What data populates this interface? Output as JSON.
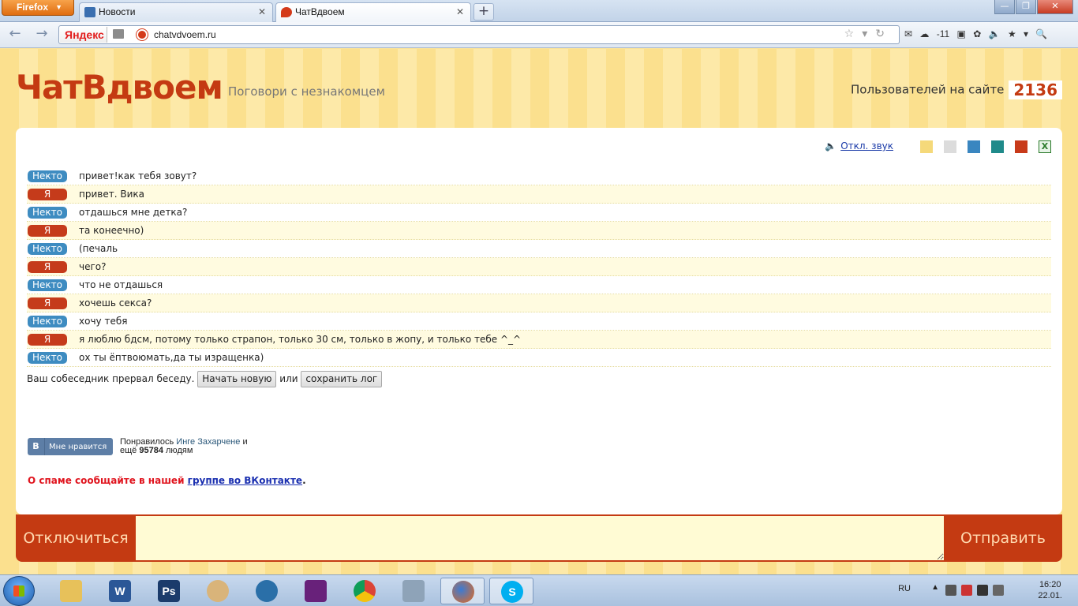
{
  "browser": {
    "menu_label": "Firefox",
    "tabs": [
      {
        "title": "Новости",
        "icon": "news-tab-icon"
      },
      {
        "title": "ЧатВдвоем",
        "icon": "chat-tab-icon"
      }
    ],
    "new_tab": "+",
    "search_engine": "Яндекс",
    "url": "chatvdvoem.ru",
    "weather": "-11",
    "window_controls": [
      "—",
      "❐",
      "✕"
    ]
  },
  "site": {
    "logo": "ЧатВдвоем",
    "tagline": "Поговори с незнакомцем",
    "users_label": "Пользователей на сайте",
    "users_count": "2136"
  },
  "toolbar": {
    "sound_label": "Откл. звук",
    "theme_colors": [
      "#f5d97a",
      "#dcdcdc",
      "#3a86c0",
      "#1f8a8a",
      "#c83a1a"
    ],
    "export_icon": "excel-icon"
  },
  "chat": {
    "messages": [
      {
        "sender": "Некто",
        "text": "привет!как тебя зовут?"
      },
      {
        "sender": "Я",
        "text": "привет. Вика"
      },
      {
        "sender": "Некто",
        "text": "отдашься мне детка?"
      },
      {
        "sender": "Я",
        "text": "та конеечно)"
      },
      {
        "sender": "Некто",
        "text": "(печаль"
      },
      {
        "sender": "Я",
        "text": "чего?"
      },
      {
        "sender": "Некто",
        "text": "что не отдашься"
      },
      {
        "sender": "Я",
        "text": "хочешь секса?"
      },
      {
        "sender": "Некто",
        "text": "хочу тебя"
      },
      {
        "sender": "Я",
        "text": "я люблю бдсм, потому только страпон, только 30 см, только в жопу, и только тебе ^_^"
      },
      {
        "sender": "Некто",
        "text": "ох ты ёптвоюмать,да ты изращенка)"
      }
    ],
    "ended_text": "Ваш собеседник прервал беседу.",
    "new_button": "Начать новую",
    "or_text": "или",
    "save_button": "сохранить лог"
  },
  "vk": {
    "logo_letter": "В",
    "like_label": "Мне нравится",
    "liked_prefix": "Понравилось",
    "liked_name": "Инге Захарченe",
    "liked_and": "и",
    "more_prefix": "ещё",
    "more_count": "95784",
    "more_suffix": "людям"
  },
  "spam": {
    "text": "О спаме сообщайте в нашей",
    "link": "группе во ВКонтакте",
    "end": "."
  },
  "bottom": {
    "disconnect": "Отключиться",
    "send": "Отправить",
    "input_value": ""
  },
  "taskbar": {
    "apps": [
      "explorer",
      "word",
      "photoshop",
      "paint",
      "webcam",
      "visual-studio",
      "chrome",
      "calculator",
      "firefox",
      "skype"
    ],
    "lang": "RU",
    "time": "16:20",
    "date": "22.01."
  }
}
